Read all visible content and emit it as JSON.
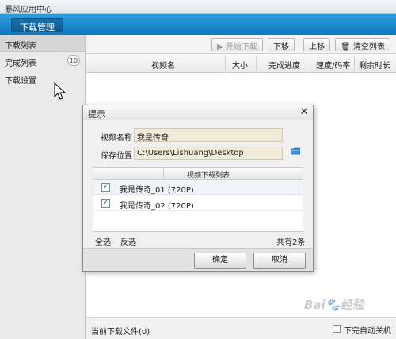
{
  "app": {
    "title": "暴风应用中心"
  },
  "nav": {
    "tab_label": "下载管理"
  },
  "sidebar": {
    "items": [
      {
        "label": "下载列表"
      },
      {
        "label": "完成列表",
        "badge": "10"
      },
      {
        "label": "下载设置"
      }
    ]
  },
  "toolbar": {
    "start_label": "开始下载",
    "down_label": "下移",
    "up_label": "上移",
    "clear_label": "清空列表"
  },
  "table": {
    "columns": [
      "视频名",
      "大小",
      "完成进度",
      "速度/码率",
      "剩余时长"
    ]
  },
  "statusbar": {
    "current_file": "当前下载文件(0)",
    "auto_shutdown_label": "下完自动关机"
  },
  "dialog": {
    "title": "提示",
    "video_name_label": "视频名称",
    "video_name_value": "我是传奇",
    "save_path_label": "保存位置",
    "save_path_value": "C:\\Users\\Lishuang\\Desktop",
    "list_header": "视频下载列表",
    "items": [
      {
        "label": "我是传奇_01 (720P)",
        "checked": true
      },
      {
        "label": "我是传奇_02 (720P)",
        "checked": true
      }
    ],
    "select_all_label": "全选",
    "invert_label": "反选",
    "count_label": "共有2条",
    "ok_label": "确定",
    "cancel_label": "取消"
  },
  "watermark": {
    "text": "Baidu 经验"
  }
}
